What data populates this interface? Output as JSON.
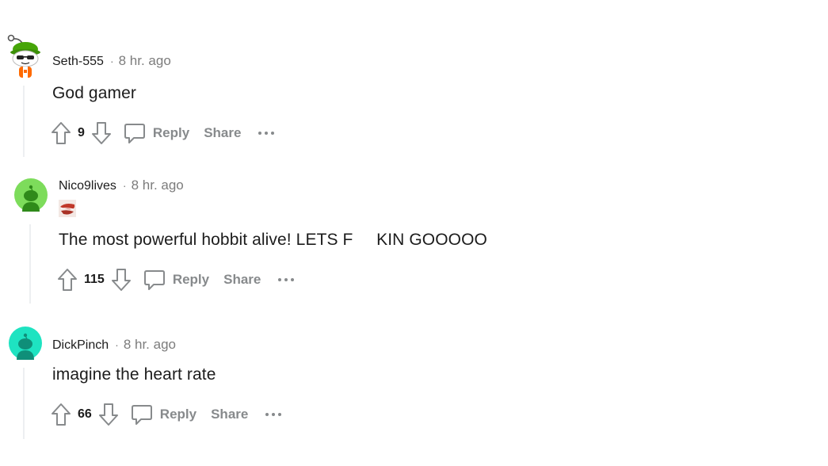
{
  "comments": [
    {
      "username": "Seth-555",
      "separator": "·",
      "time": "8 hr. ago",
      "text": "God gamer",
      "score": "9",
      "reply_label": "Reply",
      "share_label": "Share",
      "avatar_icon": "snoo-avatar-green-hat-sunglasses-icon"
    },
    {
      "username": "Nico9lives",
      "separator": "·",
      "time": "8 hr. ago",
      "text": "The most powerful hobbit alive! LETS F     KIN GOOOOO",
      "score": "115",
      "reply_label": "Reply",
      "share_label": "Share",
      "avatar_icon": "snoo-avatar-green-icon",
      "flair_icon": "red-lips-flair-icon"
    },
    {
      "username": "DickPinch",
      "separator": "·",
      "time": "8 hr. ago",
      "text": "imagine the heart rate",
      "score": "66",
      "reply_label": "Reply",
      "share_label": "Share",
      "avatar_icon": "snoo-avatar-teal-icon"
    }
  ],
  "colors": {
    "text": "#1c1c1c",
    "meta": "#7c7c7c",
    "action": "#878a8c",
    "thread_line": "#edeff1",
    "avatar_green": "#7ddc5b",
    "avatar_teal": "#1ee3c1"
  }
}
